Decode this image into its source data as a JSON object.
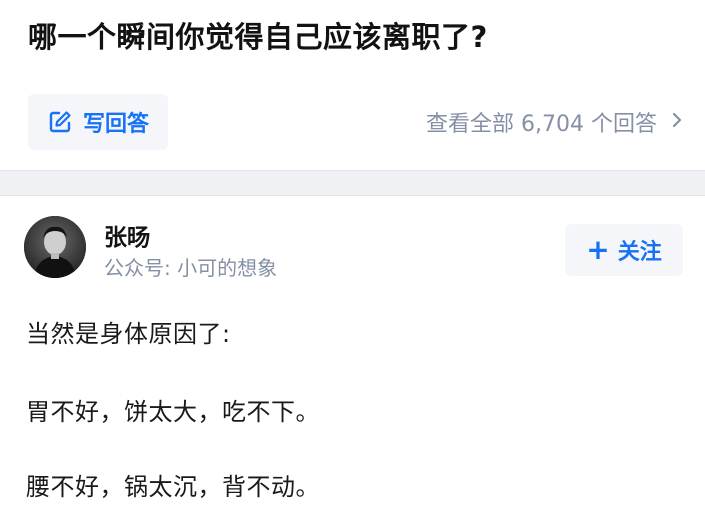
{
  "question": {
    "title": "哪一个瞬间你觉得自己应该离职了?",
    "write_answer_label": "写回答",
    "view_all_label": "查看全部 6,704 个回答"
  },
  "answer": {
    "author_name": "张旸",
    "author_subtitle": "公众号: 小可的想象",
    "follow_label": "关注",
    "paragraphs": [
      "当然是身体原因了:",
      "胃不好，饼太大，吃不下。",
      "腰不好，锅太沉，背不动。"
    ]
  },
  "icons": {
    "write": "edit-icon",
    "chevron": "chevron-right-icon",
    "plus": "plus-icon"
  },
  "colors": {
    "accent": "#1772f6",
    "muted": "#8590a6",
    "separator": "#f0f1f4"
  }
}
